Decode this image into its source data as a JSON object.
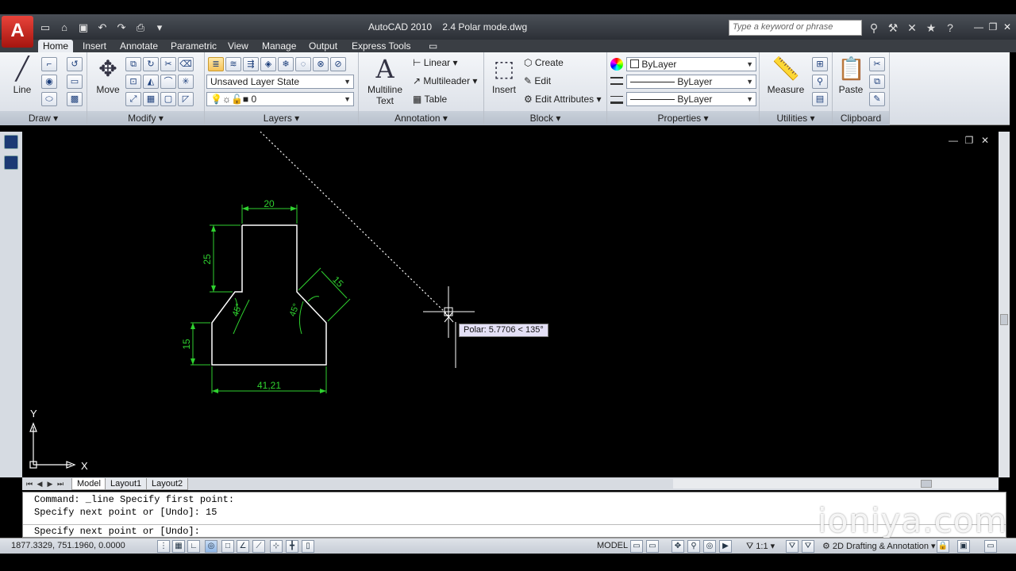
{
  "app": {
    "logo_letter": "A",
    "title": "AutoCAD 2010",
    "filename": "2.4 Polar mode.dwg",
    "search_placeholder": "Type a keyword or phrase"
  },
  "tabs": [
    "Home",
    "Insert",
    "Annotate",
    "Parametric",
    "View",
    "Manage",
    "Output",
    "Express Tools"
  ],
  "active_tab": "Home",
  "ribbon": {
    "draw": {
      "label": "Draw",
      "line_label": "Line"
    },
    "modify": {
      "label": "Modify",
      "move_label": "Move"
    },
    "layers": {
      "label": "Layers",
      "layer_state": "Unsaved Layer State",
      "current_layer": "0"
    },
    "annotation": {
      "label": "Annotation",
      "mtext_line1": "Multiline",
      "mtext_line2": "Text",
      "linear": "Linear",
      "multileader": "Multileader",
      "table": "Table"
    },
    "block": {
      "label": "Block",
      "insert": "Insert",
      "create": "Create",
      "edit": "Edit",
      "edit_attributes": "Edit Attributes"
    },
    "properties": {
      "label": "Properties",
      "color": "ByLayer",
      "linetype": "ByLayer",
      "lineweight": "ByLayer"
    },
    "utilities": {
      "label": "Utilities",
      "measure": "Measure"
    },
    "clipboard": {
      "label": "Clipboard",
      "paste": "Paste"
    }
  },
  "drawing": {
    "dim_top": "20",
    "dim_left_upper": "25",
    "dim_left_lower": "15",
    "dim_bottom": "41,21",
    "dim_diag": "15",
    "angle_left": "45°",
    "angle_right": "45°",
    "polar_tooltip": "Polar: 5.7706 < 135°",
    "ucs_x": "X",
    "ucs_y": "Y"
  },
  "layout_tabs": [
    "Model",
    "Layout1",
    "Layout2"
  ],
  "active_layout": "Model",
  "command": {
    "line1": "Command: _line Specify first point:",
    "line2": "Specify next point or [Undo]: 15",
    "prompt": "Specify next point or [Undo]:"
  },
  "watermark": "ioniya.com",
  "status": {
    "coords": "1877.3329, 751.1960, 0.0000",
    "model": "MODEL",
    "scale": "1:1",
    "workspace": "2D Drafting & Annotation"
  },
  "colors": {
    "drawing_bg": "#000000",
    "geometry": "#ffffff",
    "dimension": "#2fd12f",
    "tooltip_bg": "#e4e0f6"
  }
}
